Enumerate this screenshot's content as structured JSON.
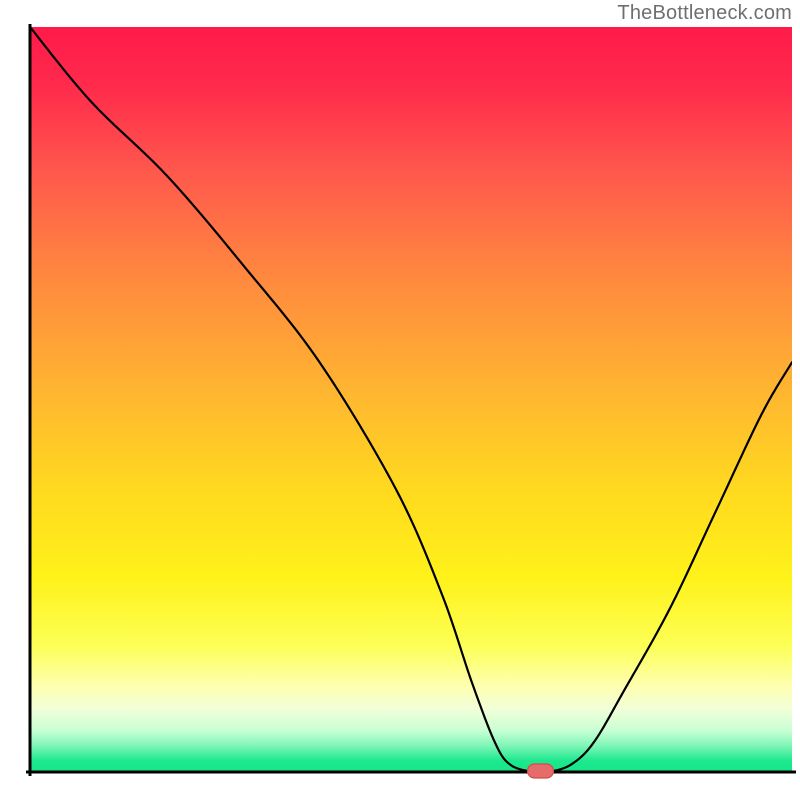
{
  "watermark": "TheBottleneck.com",
  "colors": {
    "red_top": "#ff1a4a",
    "orange": "#ffa834",
    "yellow": "#fff31a",
    "light_yellow": "#ffffa0",
    "pale_yellow": "#fbffd0",
    "green": "#1de88e",
    "axis": "#000000",
    "curve": "#000000",
    "marker_fill": "#e66b6b",
    "marker_stroke": "#d64b4b"
  },
  "chart_data": {
    "type": "line",
    "title": "",
    "xlabel": "",
    "ylabel": "",
    "xlim": [
      0,
      100
    ],
    "ylim": [
      0,
      100
    ],
    "x": [
      0,
      8,
      18,
      28,
      38,
      48,
      54,
      58,
      61,
      63,
      66,
      68,
      71,
      74,
      78,
      84,
      90,
      96,
      100
    ],
    "values": [
      100,
      90,
      80,
      68,
      55,
      38,
      24,
      12,
      4,
      1,
      0,
      0,
      1,
      4,
      11,
      22,
      35,
      48,
      55
    ],
    "marker": {
      "x": 67,
      "y": 0
    },
    "grid": false
  }
}
